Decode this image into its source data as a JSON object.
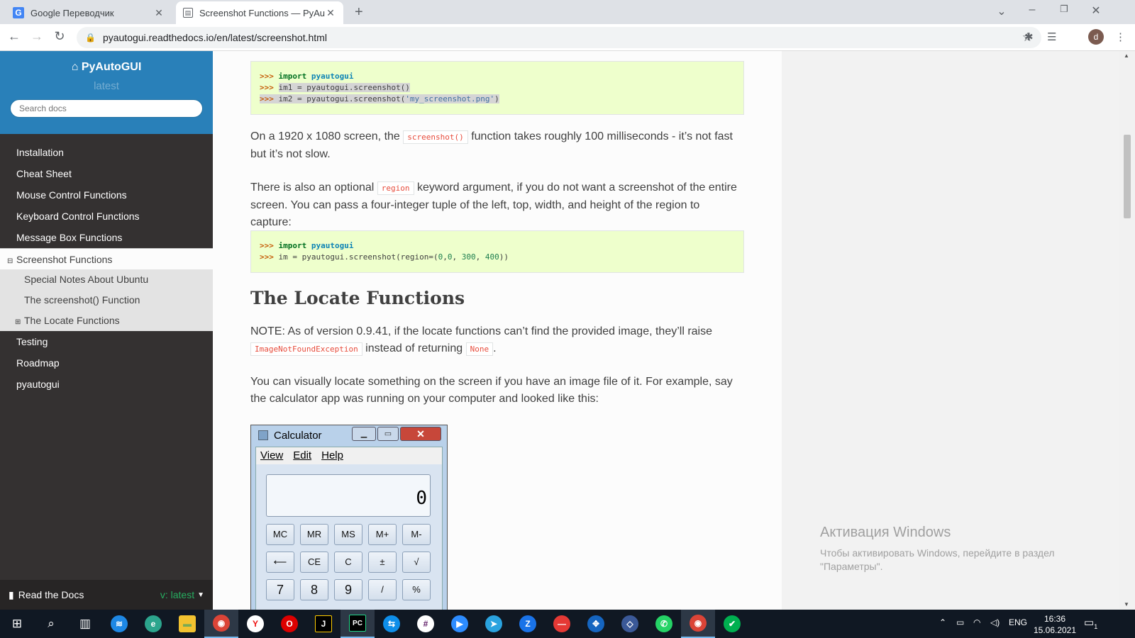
{
  "browser": {
    "tabs": [
      {
        "title": "Google Переводчик",
        "icon": "google-translate-icon"
      },
      {
        "title": "Screenshot Functions — PyAutoGUI",
        "icon": "docs-page-icon"
      }
    ],
    "url": "pyautogui.readthedocs.io/en/latest/screenshot.html",
    "profile_initial": "d"
  },
  "sidebar": {
    "project": "PyAutoGUI",
    "version": "latest",
    "search_placeholder": "Search docs",
    "items": [
      {
        "label": "Installation"
      },
      {
        "label": "Cheat Sheet"
      },
      {
        "label": "Mouse Control Functions"
      },
      {
        "label": "Keyboard Control Functions"
      },
      {
        "label": "Message Box Functions"
      },
      {
        "label": "Screenshot Functions",
        "current": true
      },
      {
        "label": "Special Notes About Ubuntu",
        "level": 2
      },
      {
        "label": "The screenshot() Function",
        "level": 2
      },
      {
        "label": "The Locate Functions",
        "level": 2
      },
      {
        "label": "Testing"
      },
      {
        "label": "Roadmap"
      },
      {
        "label": "pyautogui"
      }
    ],
    "footer": {
      "label": "Read the Docs",
      "version": "v: latest"
    }
  },
  "content": {
    "code1": {
      "prompt": ">>>",
      "line1_kw": "import",
      "line1_mod": "pyautogui",
      "line2": "im1 = pyautogui.screenshot()",
      "line3_a": "im2 = pyautogui.screenshot(",
      "line3_str": "'my_screenshot.png'",
      "line3_b": ")"
    },
    "p1": {
      "a": "On a 1920 x 1080 screen, the",
      "code": "screenshot()",
      "b": "function takes roughly 100 milliseconds - it’s not fast but it’s not slow."
    },
    "p2": {
      "a": "There is also an optional",
      "code": "region",
      "b": "keyword argument, if you do not want a screenshot of the entire screen. You can pass a four-integer tuple of the left, top, width, and height of the region to capture:"
    },
    "code2": {
      "line2_a": "im = pyautogui.screenshot(region=(",
      "n1": "0",
      "n2": "0",
      "n3": "300",
      "n4": "400",
      "sep": ",",
      "sep2": ", ",
      "line2_b": "))"
    },
    "heading": "The Locate Functions",
    "p3": {
      "a": "NOTE: As of version 0.9.41, if the locate functions can’t find the provided image, they’ll raise",
      "code1": "ImageNotFoundException",
      "b": "instead of returning",
      "code2": "None",
      "c": "."
    },
    "p4": "You can visually locate something on the screen if you have an image file of it. For example, say the calculator app was running on your computer and looked like this:",
    "calculator": {
      "title": "Calculator",
      "menu": [
        "View",
        "Edit",
        "Help"
      ],
      "display": "0",
      "rows": [
        [
          "MC",
          "MR",
          "MS",
          "M+",
          "M-"
        ],
        [
          "⟵",
          "CE",
          "C",
          "±",
          "√"
        ],
        [
          "7",
          "8",
          "9",
          "/",
          "%"
        ]
      ]
    }
  },
  "watermark": {
    "title": "Активация Windows",
    "text": "Чтобы активировать Windows, перейдите в раздел \"Параметры\"."
  },
  "taskbar": {
    "lang": "ENG",
    "time": "16:36",
    "date": "15.06.2021",
    "notifications": "1"
  }
}
